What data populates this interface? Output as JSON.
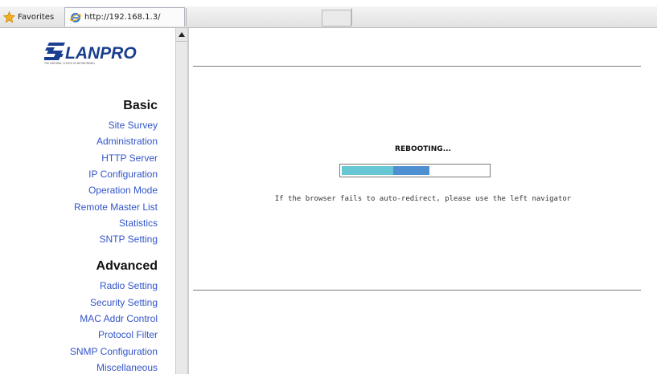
{
  "browser": {
    "favorites_label": "Favorites",
    "tab_title": "http://192.168.1.3/"
  },
  "sidebar": {
    "logo_text": "LANPRO",
    "logo_tagline": "THE NATURAL CHOICE IN NETWORKING",
    "sections": [
      {
        "heading": "Basic",
        "items": [
          {
            "label": "Site Survey"
          },
          {
            "label": "Administration"
          },
          {
            "label": "HTTP Server"
          },
          {
            "label": "IP Configuration"
          },
          {
            "label": "Operation Mode"
          },
          {
            "label": "Remote Master List"
          },
          {
            "label": "Statistics"
          },
          {
            "label": "SNTP Setting"
          }
        ]
      },
      {
        "heading": "Advanced",
        "items": [
          {
            "label": "Radio Setting"
          },
          {
            "label": "Security Setting"
          },
          {
            "label": "MAC Addr Control"
          },
          {
            "label": "Protocol Filter"
          },
          {
            "label": "SNMP Configuration"
          },
          {
            "label": "Miscellaneous"
          }
        ]
      }
    ]
  },
  "main": {
    "status_title": "REBOOTING...",
    "progress_fraction": 0.6,
    "hint_text": "If the browser fails to auto-redirect, please use the left navigator"
  },
  "colors": {
    "link": "#3355c9",
    "progress_light": "#67c6d3",
    "progress_dark": "#4d8fd0",
    "logo_blue": "#1a3f8f"
  }
}
